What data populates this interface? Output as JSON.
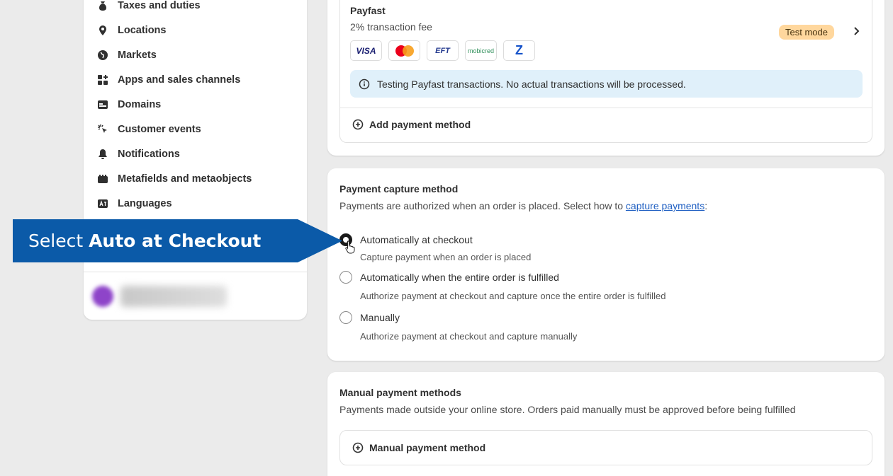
{
  "sidebar": {
    "items": [
      {
        "label": "Taxes and duties",
        "icon": "money-bag-icon"
      },
      {
        "label": "Locations",
        "icon": "location-pin-icon"
      },
      {
        "label": "Markets",
        "icon": "globe-icon"
      },
      {
        "label": "Apps and sales channels",
        "icon": "apps-icon"
      },
      {
        "label": "Domains",
        "icon": "domains-icon"
      },
      {
        "label": "Customer events",
        "icon": "cursor-click-icon"
      },
      {
        "label": "Notifications",
        "icon": "bell-icon"
      },
      {
        "label": "Metafields and metaobjects",
        "icon": "metafields-icon"
      },
      {
        "label": "Languages",
        "icon": "languages-icon"
      }
    ]
  },
  "payfast": {
    "name": "Payfast",
    "fee": "2% transaction fee",
    "badge": "Test mode",
    "logos": [
      "VISA",
      "Mastercard",
      "EFT",
      "mobicred",
      "Zapper"
    ],
    "visa_text": "VISA",
    "eft_text": "EFT",
    "mobicred_text": "mobicred",
    "zapper_text": "Z",
    "banner": "Testing Payfast transactions. No actual transactions will be processed.",
    "add_payment_method": "Add payment method"
  },
  "capture": {
    "title": "Payment capture method",
    "subtitle_prefix": "Payments are authorized when an order is placed. Select how to ",
    "subtitle_link": "capture payments",
    "subtitle_suffix": ":",
    "options": [
      {
        "label": "Automatically at checkout",
        "help": "Capture payment when an order is placed",
        "checked": true
      },
      {
        "label": "Automatically when the entire order is fulfilled",
        "help": "Authorize payment at checkout and capture once the entire order is fulfilled",
        "checked": false
      },
      {
        "label": "Manually",
        "help": "Authorize payment at checkout and capture manually",
        "checked": false
      }
    ]
  },
  "manual": {
    "title": "Manual payment methods",
    "subtitle": "Payments made outside your online store. Orders paid manually must be approved before being fulfilled",
    "button": "Manual payment method"
  },
  "callout": {
    "prefix": "Select ",
    "emphasis": "Auto at Checkout",
    "color": "#0b5aa8"
  },
  "colors": {
    "badge_bg": "#ffd79d",
    "banner_bg": "#e0f0fa",
    "link": "#1f5fc2"
  }
}
